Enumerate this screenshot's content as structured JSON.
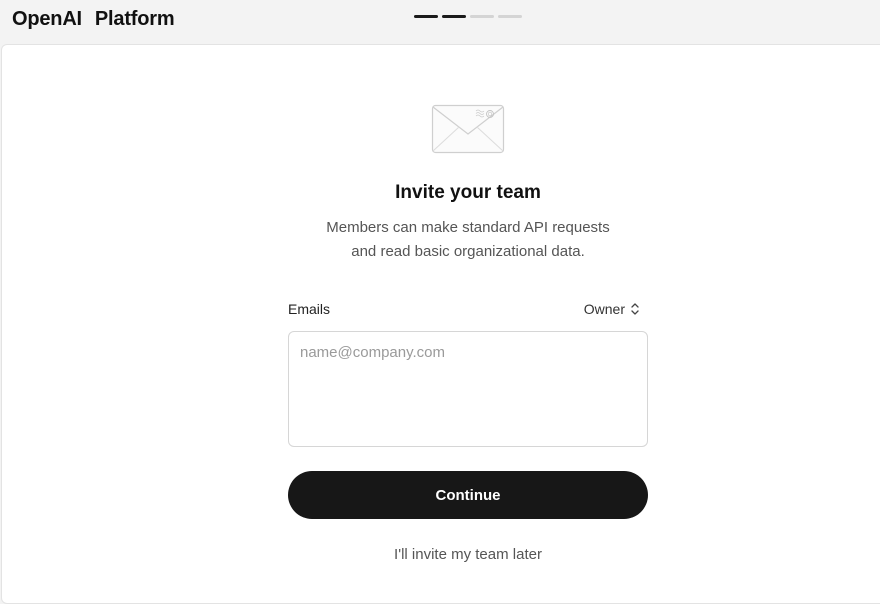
{
  "header": {
    "brand_part1": "OpenAI",
    "brand_part2": "Platform",
    "progress": {
      "total_steps": 4,
      "completed_steps": 2
    }
  },
  "main": {
    "illustration_icon": "envelope-icon",
    "title": "Invite your team",
    "subtitle_line1": "Members can make standard API requests",
    "subtitle_line2": "and read basic organizational data.",
    "emails_label": "Emails",
    "role_selected": "Owner",
    "role_icon": "chevron-up-down-icon",
    "email_input": {
      "value": "",
      "placeholder": "name@company.com"
    },
    "continue_label": "Continue",
    "later_label": "I'll invite my team later"
  },
  "colors": {
    "page_bg": "#f3f3f3",
    "card_bg": "#ffffff",
    "button_bg": "#171717",
    "button_text": "#ffffff",
    "progress_done": "#1a1a1a",
    "progress_pending": "#d4d4d4"
  }
}
